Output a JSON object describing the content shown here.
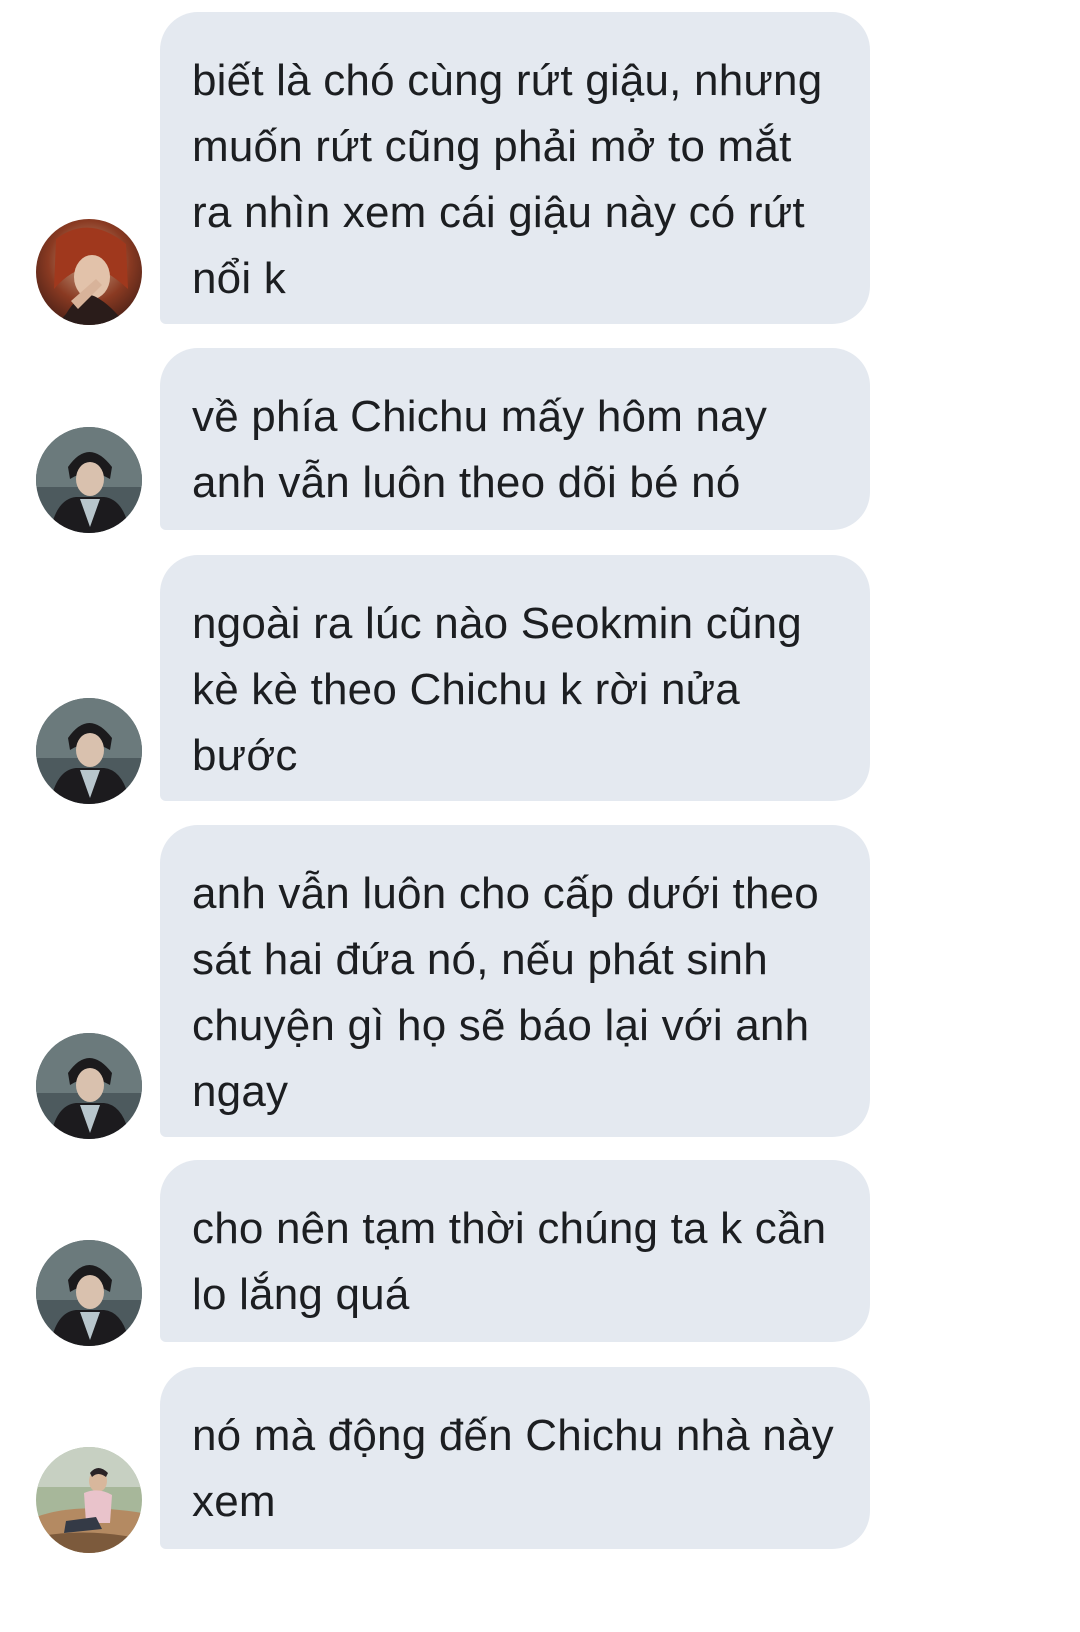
{
  "conversation": {
    "messages": [
      {
        "sender": "red-hair-user",
        "text": "biết là chó cùng rứt giậu, nhưng muốn rứt cũng phải mở to mắt ra nhìn xem cái giậu này có rứt nổi k"
      },
      {
        "sender": "dark-jacket-user",
        "text": "về phía Chichu mấy hôm nay anh vẫn luôn theo dõi bé nó"
      },
      {
        "sender": "dark-jacket-user",
        "text": "ngoài ra lúc nào Seokmin cũng kè kè theo Chichu k rời nửa bước"
      },
      {
        "sender": "dark-jacket-user",
        "text": "anh vẫn luôn cho cấp dưới theo sát hai đứa nó, nếu phát sinh chuyện gì họ sẽ báo lại với anh ngay"
      },
      {
        "sender": "dark-jacket-user",
        "text": "cho nên tạm thời chúng ta k cần lo lắng quá"
      },
      {
        "sender": "outdoor-user",
        "text": "nó mà động đến Chichu nhà này xem"
      }
    ]
  },
  "colors": {
    "bubble_bg": "#e4e9f0",
    "text": "#1c1e21",
    "page_bg": "#ffffff"
  }
}
